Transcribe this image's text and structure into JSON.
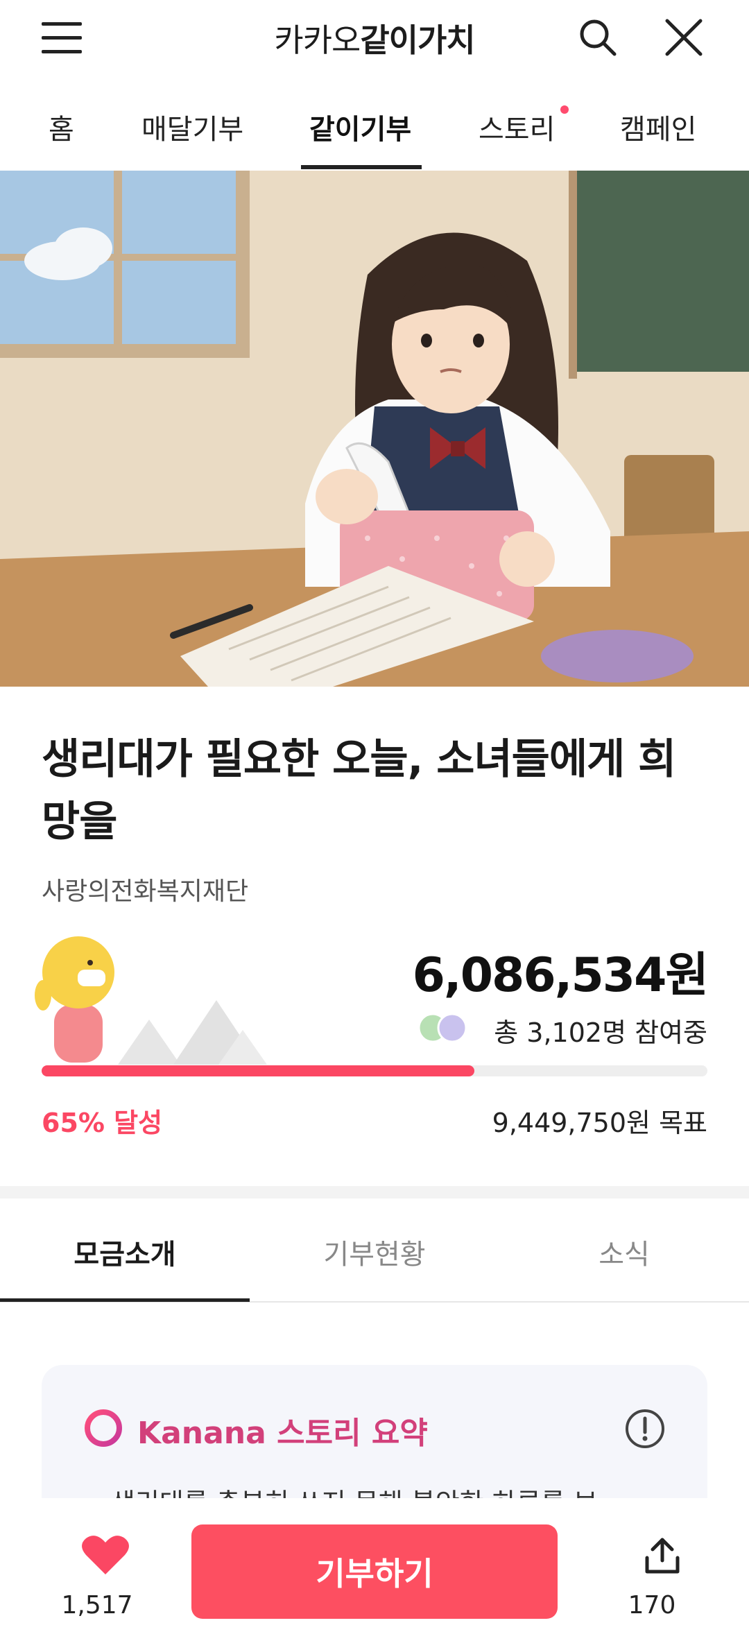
{
  "header": {
    "brand_part1": "카카오",
    "brand_part2": "같이가치",
    "icons": [
      "menu-icon",
      "search-icon",
      "close-icon"
    ]
  },
  "nav": {
    "tabs": [
      "홈",
      "매달기부",
      "같이기부",
      "스토리",
      "캠페인"
    ],
    "active_tab": "같이기부"
  },
  "campaign": {
    "title": "생리대가 필요한 오늘, 소녀들에게 희망을",
    "organization": "사랑의전화복지재단",
    "amount_raised": "6,086,534원",
    "participants": "총 3,102명 참여중",
    "progress_percent": 65,
    "progress_label": "65% 달성",
    "goal": "9,449,750원 목표"
  },
  "section_tabs": {
    "tabs": [
      "모금소개",
      "기부현황",
      "소식"
    ],
    "active_tab": "모금소개"
  },
  "summary_card": {
    "title": "Kanana 스토리 요약",
    "preview_text": "생리대를 충분히 쓰지 못해 불안한 하루를 보"
  },
  "bottom_bar": {
    "like_count": "1,517",
    "donate_label": "기부하기",
    "share_count": "170"
  },
  "colors": {
    "accent": "#fb4763",
    "donate_button": "#fd4f61",
    "kanana": "#d2407a"
  }
}
